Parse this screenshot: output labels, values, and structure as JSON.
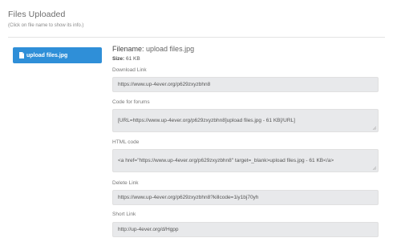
{
  "header": {
    "title": "Files Uploaded",
    "subtitle": "(Click on file name to show its info.)"
  },
  "file_button": {
    "label": "upload files.jpg",
    "icon": "document-icon",
    "color": "#2f8fd8"
  },
  "details": {
    "filename_label": "Filename:",
    "filename_value": "upload files.jpg",
    "size_label": "Size:",
    "size_value": "61 KB"
  },
  "fields": {
    "download": {
      "label": "Download Link",
      "value": "https://www.up-4ever.org/p629zxyzbhn8"
    },
    "forum": {
      "label": "Code for forums",
      "value": "[URL=https://www.up-4ever.org/p629zxyzbhn8]upload files.jpg -  61 KB[/URL]"
    },
    "html": {
      "label": "HTML code",
      "value": "<a href=\"https://www.up-4ever.org/p629zxyzbhn8\" target=_blank>upload files.jpg - 61 KB</a>"
    },
    "delete": {
      "label": "Delete Link",
      "value": "https://www.up-4ever.org/p629zxyzbhn8?killcode=1iy1bj70yh"
    },
    "short": {
      "label": "Short Link",
      "value": "http://up-4ever.org/d/Hgpp"
    }
  }
}
